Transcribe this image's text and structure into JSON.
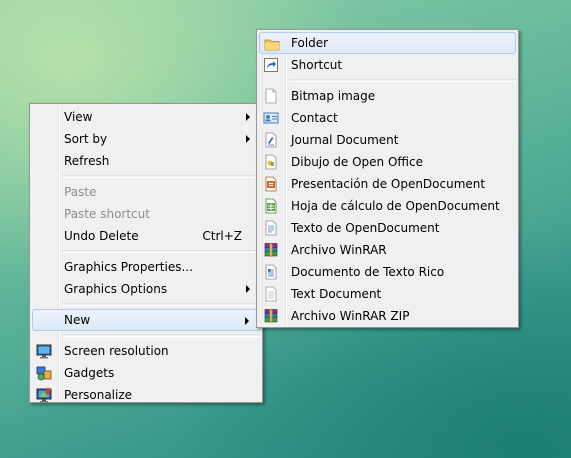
{
  "context_menu": {
    "items": [
      {
        "label": "View",
        "submenu": true
      },
      {
        "label": "Sort by",
        "submenu": true
      },
      {
        "label": "Refresh"
      },
      {
        "label": "Paste",
        "disabled": true
      },
      {
        "label": "Paste shortcut",
        "disabled": true
      },
      {
        "label": "Undo Delete",
        "shortcut": "Ctrl+Z"
      },
      {
        "label": "Graphics Properties..."
      },
      {
        "label": "Graphics Options",
        "submenu": true
      },
      {
        "label": "New",
        "submenu": true,
        "highlighted": true
      },
      {
        "label": "Screen resolution",
        "icon": "monitor-icon"
      },
      {
        "label": "Gadgets",
        "icon": "gadgets-icon"
      },
      {
        "label": "Personalize",
        "icon": "personalize-icon"
      }
    ]
  },
  "new_submenu": {
    "items": [
      {
        "label": "Folder",
        "icon": "folder-icon",
        "highlighted": true
      },
      {
        "label": "Shortcut",
        "icon": "shortcut-icon"
      },
      {
        "label": "Bitmap image",
        "icon": "bitmap-file-icon"
      },
      {
        "label": "Contact",
        "icon": "contact-card-icon"
      },
      {
        "label": "Journal Document",
        "icon": "journal-document-icon"
      },
      {
        "label": "Dibujo de Open Office",
        "icon": "openoffice-drawing-icon"
      },
      {
        "label": "Presentación de OpenDocument",
        "icon": "opendocument-presentation-icon"
      },
      {
        "label": "Hoja de cálculo de OpenDocument",
        "icon": "opendocument-spreadsheet-icon"
      },
      {
        "label": "Texto de OpenDocument",
        "icon": "opendocument-text-icon"
      },
      {
        "label": "Archivo WinRAR",
        "icon": "winrar-archive-icon"
      },
      {
        "label": "Documento de Texto Rico",
        "icon": "rich-text-document-icon"
      },
      {
        "label": "Text Document",
        "icon": "text-document-icon"
      },
      {
        "label": "Archivo WinRAR ZIP",
        "icon": "winrar-zip-icon"
      }
    ]
  }
}
